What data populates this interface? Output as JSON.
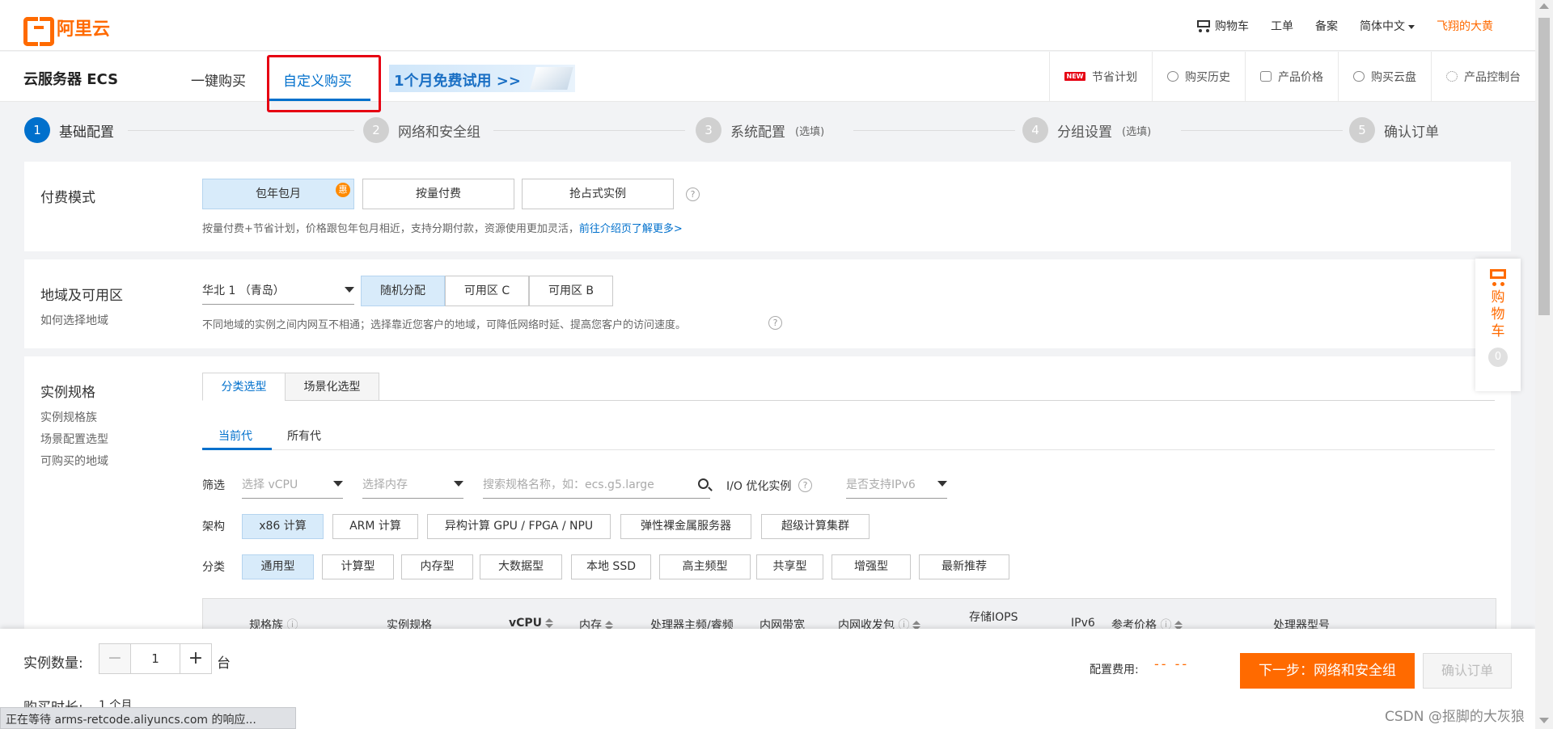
{
  "header": {
    "logo": "阿里云",
    "cart": "购物车",
    "tickets": "工单",
    "filing": "备案",
    "language": "简体中文",
    "user": "飞翔的大黄"
  },
  "subbar": {
    "product": "云服务器 ECS",
    "tab_quick": "一键购买",
    "tab_custom": "自定义购买",
    "trial": "1个月免费试用 >>",
    "links": [
      "节省计划",
      "购买历史",
      "产品价格",
      "购买云盘",
      "产品控制台"
    ],
    "new_badge": "NEW"
  },
  "steps": [
    {
      "num": "1",
      "label": "基础配置"
    },
    {
      "num": "2",
      "label": "网络和安全组"
    },
    {
      "num": "3",
      "label": "系统配置",
      "note": "(选填)"
    },
    {
      "num": "4",
      "label": "分组设置",
      "note": "(选填)"
    },
    {
      "num": "5",
      "label": "确认订单"
    }
  ],
  "billing": {
    "title": "付费模式",
    "options": [
      "包年包月",
      "按量付费",
      "抢占式实例"
    ],
    "badge": "惠",
    "tip": "按量付费+节省计划，价格跟包年包月相近，支持分期付款，资源使用更加灵活，",
    "tip_link": "前往介绍页了解更多>"
  },
  "region": {
    "title": "地域及可用区",
    "sub": "如何选择地域",
    "selected": "华北 1 （青岛）",
    "zones": [
      "随机分配",
      "可用区 C",
      "可用区 B"
    ],
    "tip": "不同地域的实例之间内网互不相通；选择靠近您客户的地域，可降低网络时延、提高您客户的访问速度。"
  },
  "instance": {
    "title": "实例规格",
    "links": [
      "实例规格族",
      "场景配置选型",
      "可购买的地域"
    ],
    "tabs": [
      "分类选型",
      "场景化选型"
    ],
    "subtabs": [
      "当前代",
      "所有代"
    ],
    "filter_label": "筛选",
    "vcpu_ph": "选择 vCPU",
    "mem_ph": "选择内存",
    "search_ph": "搜索规格名称，如：ecs.g5.large",
    "io_opt": "I/O 优化实例",
    "ipv6_ph": "是否支持IPv6",
    "arch_label": "架构",
    "arch": [
      "x86 计算",
      "ARM 计算",
      "异构计算 GPU / FPGA / NPU",
      "弹性裸金属服务器",
      "超级计算集群"
    ],
    "cat_label": "分类",
    "categories": [
      "通用型",
      "计算型",
      "内存型",
      "大数据型",
      "本地 SSD",
      "高主频型",
      "共享型",
      "增强型",
      "最新推荐"
    ],
    "columns": [
      "规格族",
      "实例规格",
      "vCPU",
      "内存",
      "处理器主频/睿频",
      "内网带宽",
      "内网收发包",
      "存储IOPS",
      "IPv6",
      "参考价格",
      "处理器型号"
    ]
  },
  "bottom": {
    "qty_label": "实例数量:",
    "qty": "1",
    "minus": "−",
    "plus": "+",
    "unit": "台",
    "duration_label": "购买时长:",
    "duration": "1 个月",
    "fee_label": "配置费用:",
    "fee_value": "-- --",
    "next": "下一步：网络和安全组",
    "confirm": "确认订单"
  },
  "float_cart": {
    "text": "购物车",
    "count": "0"
  },
  "status_text": "正在等待 arms-retcode.aliyuncs.com 的响应...",
  "watermark": "CSDN @抠脚的大灰狼",
  "colors": {
    "accent": "#ff6a00",
    "primary": "#0070cc",
    "highlight": "#e60012"
  }
}
